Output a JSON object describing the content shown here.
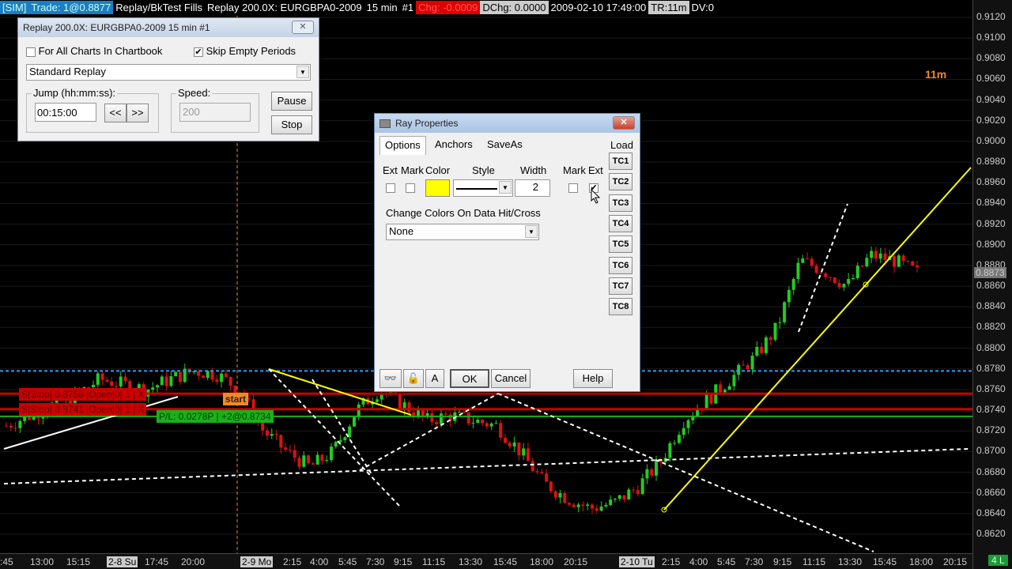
{
  "topbar": {
    "sim": "[SIM]",
    "trade": "Trade: 1@0.8877",
    "fills": "Replay/BkTest Fills",
    "replay": "Replay 200.0X: EURGBPA0-2009",
    "interval": "15 min",
    "chart_num": "#1",
    "chg": "Chg: -0.0009",
    "dchg": "DChg: 0.0000",
    "datetime": "2009-02-10 17:49:00",
    "tr": "TR:11m",
    "dv": "DV:0"
  },
  "colors": {
    "up": "#22cc22",
    "down": "#dd1111",
    "ray": "#ffff00",
    "stop": "#cc0000",
    "pl": "#1ab01a",
    "accent": "#f08a20"
  },
  "price_axis": [
    "0.9120",
    "0.9100",
    "0.9080",
    "0.9060",
    "0.9040",
    "0.9020",
    "0.9000",
    "0.8980",
    "0.8960",
    "0.8940",
    "0.8920",
    "0.8900",
    "0.8880",
    "0.8860",
    "0.8840",
    "0.8820",
    "0.8800",
    "0.8780",
    "0.8760",
    "0.8740",
    "0.8720",
    "0.8700",
    "0.8680",
    "0.8660",
    "0.8640",
    "0.8620"
  ],
  "last_price": "0.8873",
  "time_axis": [
    {
      "t": ":45"
    },
    {
      "t": "13:00"
    },
    {
      "t": "15:15"
    },
    {
      "t": "2-8 Su",
      "date": true
    },
    {
      "t": "17:45"
    },
    {
      "t": "20:00"
    },
    {
      "t": "2-9 Mo",
      "date": true
    },
    {
      "t": "2:15"
    },
    {
      "t": "4:00"
    },
    {
      "t": "5:45"
    },
    {
      "t": "7:30"
    },
    {
      "t": "9:15"
    },
    {
      "t": "11:15"
    },
    {
      "t": "13:30"
    },
    {
      "t": "15:45"
    },
    {
      "t": "18:00"
    },
    {
      "t": "20:15"
    },
    {
      "t": "2-10 Tu",
      "date": true
    },
    {
      "t": "2:15"
    },
    {
      "t": "4:00"
    },
    {
      "t": "5:45"
    },
    {
      "t": "7:30"
    },
    {
      "t": "9:15"
    },
    {
      "t": "11:15"
    },
    {
      "t": "13:30"
    },
    {
      "t": "15:45"
    },
    {
      "t": "18:00"
    },
    {
      "t": "20:15"
    }
  ],
  "corner_label": "4 L",
  "bar_timer": "11m",
  "price_path": [
    0.8725,
    0.8735,
    0.8745,
    0.8755,
    0.877,
    0.8765,
    0.876,
    0.877,
    0.8778,
    0.8775,
    0.876,
    0.872,
    0.87,
    0.8685,
    0.87,
    0.874,
    0.876,
    0.8745,
    0.873,
    0.8735,
    0.873,
    0.8725,
    0.87,
    0.867,
    0.8655,
    0.8645,
    0.865,
    0.8665,
    0.869,
    0.873,
    0.875,
    0.877,
    0.879,
    0.882,
    0.8885,
    0.8875,
    0.886,
    0.889,
    0.8885,
    0.8873
  ],
  "orders": [
    {
      "label": "S|Stop| 0.8756 |Open|0| 1 | X"
    },
    {
      "label": "S|Stop| 0.8741 |Open|0| 1 | X"
    }
  ],
  "position": {
    "label": "P/L: 0.0278P | +2@0.8734"
  },
  "start_label": "start",
  "replay_dialog": {
    "title": "Replay 200.0X: EURGBPA0-2009  15 min   #1",
    "close": "✕",
    "for_all": "For All Charts In Chartbook",
    "for_all_checked": false,
    "skip_empty": "Skip Empty Periods",
    "skip_empty_checked": true,
    "mode": "Standard Replay",
    "jump_label": "Jump (hh:mm:ss):",
    "jump_value": "00:15:00",
    "back": "<<",
    "fwd": ">>",
    "speed_label": "Speed:",
    "speed_value": "200",
    "pause": "Pause",
    "stop": "Stop"
  },
  "ray_dialog": {
    "title": "Ray Properties",
    "close": "✕",
    "tabs": [
      "Options",
      "Anchors",
      "SaveAs"
    ],
    "load": "Load",
    "tc": [
      "TC1",
      "TC2",
      "TC3",
      "TC4",
      "TC5",
      "TC6",
      "TC7",
      "TC8"
    ],
    "ext": "Ext",
    "mark": "Mark",
    "color": "Color",
    "style": "Style",
    "width": "Width",
    "mark2": "Mark",
    "ext2": "Ext",
    "width_value": "2",
    "line_color": "#ffff00",
    "ext_checked": false,
    "mark_checked": false,
    "mark2_checked": false,
    "ext2_checked": true,
    "change_colors_label": "Change Colors On Data Hit/Cross",
    "change_colors_value": "None",
    "a_btn": "A",
    "ok": "OK",
    "cancel": "Cancel",
    "help": "Help"
  }
}
